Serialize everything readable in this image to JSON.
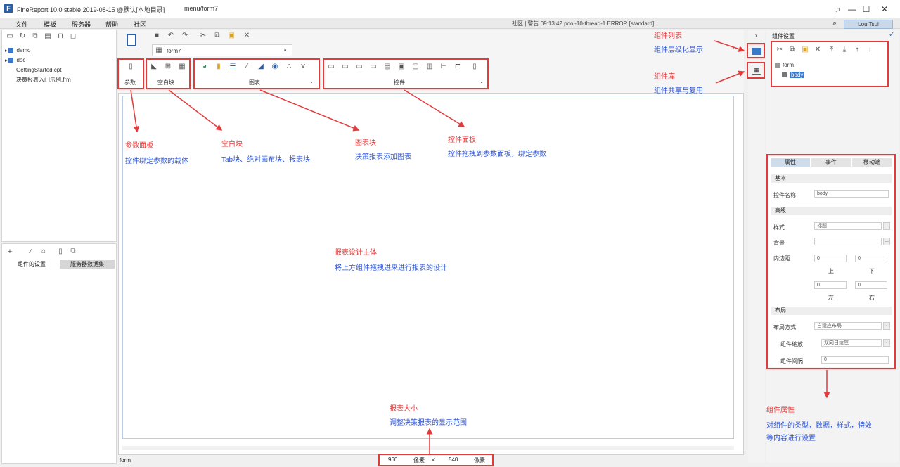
{
  "window": {
    "app_title": "FineReport 10.0 stable 2019-08-15 @默认[本地目录]",
    "doc_path": "menu/form7",
    "logo_glyph": "F",
    "min_glyph": "—",
    "max_glyph": "☐",
    "close_glyph": "✕"
  },
  "menu": {
    "items": [
      "文件",
      "模板",
      "服务器",
      "帮助",
      "社区"
    ],
    "status_info": "社区 | 警告 09:13:42 pool-10-thread-1 ERROR [standard]",
    "user": "Lou Tsui"
  },
  "left_panel": {
    "tree": [
      "demo",
      "doc",
      "GettingStarted.cpt",
      "决策报表入门示例.frm"
    ],
    "bottom_tabs": [
      "组件的设置",
      "服务器数据集"
    ]
  },
  "editor": {
    "tab_title": "form7",
    "tab_close": "×",
    "groups": {
      "param": "参数",
      "blank": "空白块",
      "chart": "图表",
      "widget": "控件"
    },
    "footer_left": "form",
    "size": {
      "width": "960",
      "width_unit": "像素",
      "x": "x",
      "height": "540",
      "height_unit": "像素"
    }
  },
  "annotations": {
    "param_title": "参数面板",
    "param_desc": "控件绑定参数的载体",
    "blank_title": "空白块",
    "blank_desc": "Tab块、绝对画布块、报表块",
    "chart_title": "图表块",
    "chart_desc": "决策报表添加图表",
    "widget_title": "控件面板",
    "widget_desc": "控件拖拽到参数面板，绑定参数",
    "body_title": "报表设计主体",
    "body_desc": "将上方组件拖拽进来进行报表的设计",
    "size_title": "报表大小",
    "size_desc": "调整决策报表的显示范围",
    "list_title": "组件列表",
    "list_desc": "组件层级化显示",
    "lib_title": "组件库",
    "lib_desc": "组件共享与复用",
    "attr_title": "组件属性",
    "attr_desc_1": "对组件的类型，数据，样式，特效",
    "attr_desc_2": "等内容进行设置"
  },
  "right_panel": {
    "header": "组件设置",
    "tree_root": "form",
    "tree_child": "body",
    "tabs": [
      "属性",
      "事件",
      "移动端"
    ],
    "sections": {
      "basic": "基本",
      "appearance": "高级",
      "layout": "布局"
    },
    "fields": {
      "name_label": "控件名称",
      "name_value": "body",
      "style_label": "样式",
      "style_value": "标题",
      "bg_label": "背景",
      "padding_label": "内边距",
      "pad_values": [
        "0",
        "0",
        "0",
        "0"
      ],
      "pad_top": "上",
      "pad_bottom": "下",
      "pad_left": "左",
      "pad_right": "右",
      "layout_mode_label": "布局方式",
      "layout_mode_value": "自适应布局",
      "widget_scale_label": "组件缩放",
      "widget_scale_value": "双向自适应",
      "widget_gap_label": "组件间隔",
      "widget_gap_value": "0"
    }
  },
  "colors": {
    "annotation_red": "#e23b3b",
    "annotation_blue": "#2e55d6",
    "accent": "#2b5fa8"
  }
}
